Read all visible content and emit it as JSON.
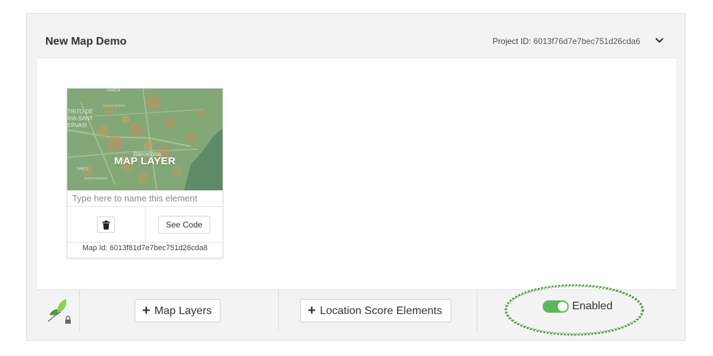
{
  "project": {
    "title": "New Map Demo",
    "id_label": "Project ID:",
    "id_value": "6013f76d7e7bec751d26cda6"
  },
  "icons": {
    "collapse": "chevron-down-icon",
    "delete": "trash-icon",
    "logo": "leaf-logo-icon",
    "lock": "lock-icon",
    "add": "plus-icon"
  },
  "card": {
    "thumbnail_label": "MAP LAYER",
    "map_text": [
      "GRACIA",
      "VILA DE GRACIA",
      "TRITO DE",
      "RIA-SANT",
      "ERVASI",
      "Barcelona",
      "SANTS",
      "HOSTAFRANCS"
    ],
    "name_placeholder": "Type here to name this element",
    "see_code_label": "See Code",
    "map_id_label": "Map Id:",
    "map_id_value": "6013f81d7e7bec751d26cda8"
  },
  "footer": {
    "map_layers_label": "Map Layers",
    "location_score_label": "Location Score Elements",
    "toggle_label": "Enabled",
    "toggle_on": true
  },
  "colors": {
    "toggle": "#5cb85c",
    "annotation": "#4e9a3a",
    "leaf_light": "#8ecf5a",
    "leaf_dark": "#4e9a3a"
  }
}
